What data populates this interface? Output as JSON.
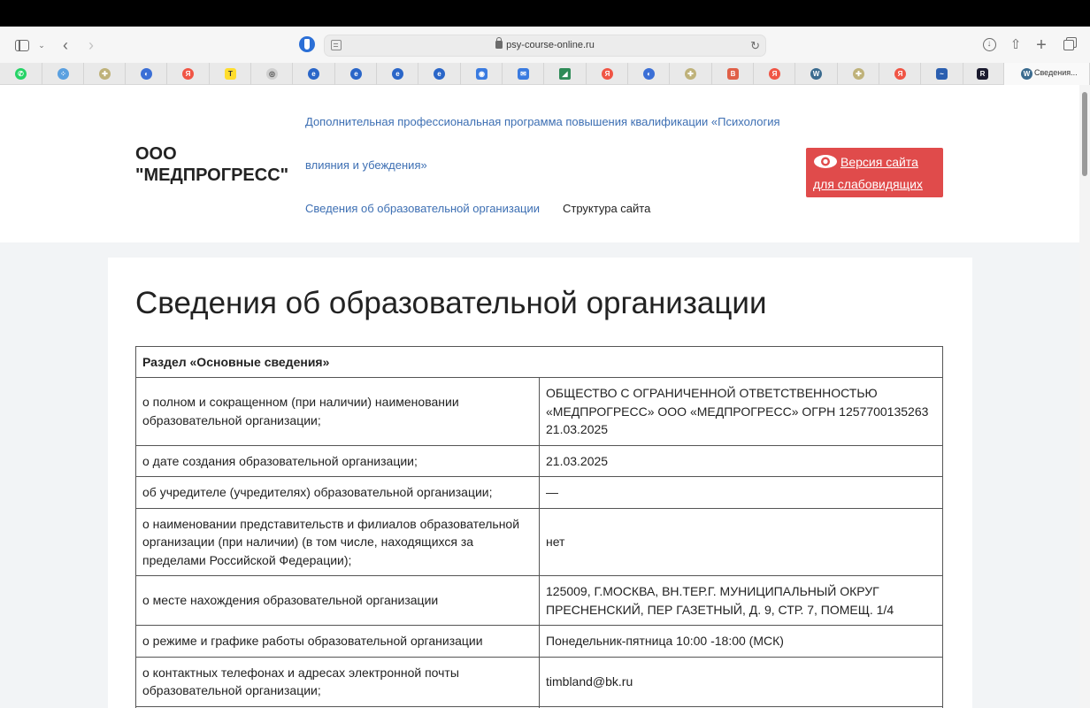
{
  "browser": {
    "url": "psy-course-online.ru",
    "active_tab_label": "Сведения...",
    "tab_icons": [
      "whatsapp-icon",
      "apps-icon",
      "medical-cross-icon",
      "chrome-icon",
      "yandex-icon",
      "tinkoff-icon",
      "university-icon",
      "edge-icon",
      "edge-icon",
      "edge-icon",
      "edge-icon",
      "circle-app-icon",
      "mail-icon",
      "chart-icon",
      "yandex-icon",
      "chrome-icon",
      "medical-cross-icon",
      "red-app-icon",
      "yandex-icon",
      "wordpress-icon",
      "medical-cross-icon",
      "yandex-icon",
      "wave-icon",
      "app-r-icon",
      "wordpress-icon"
    ]
  },
  "site": {
    "brand": "ООО \"МЕДПРОГРЕСС\"",
    "nav": {
      "program_line1": "Дополнительная профессиональная программа повышения квалификации «Психология",
      "program_line2": "влияния и убеждения»",
      "info": "Сведения об образовательной организации",
      "structure": "Структура сайта"
    },
    "accessibility_button": "Версия сайта для слабовидящих",
    "colors": {
      "accent": "#e04b4b",
      "link": "#3d6fb3",
      "page_bg": "#f2f4f6"
    }
  },
  "main": {
    "title": "Сведения об образовательной организации",
    "section_header": "Раздел «Основные сведения»",
    "rows": [
      {
        "label": "о полном и сокращенном (при наличии) наименовании образовательной организации;",
        "value": "ОБЩЕСТВО С ОГРАНИЧЕННОЙ ОТВЕТСТВЕННОСТЬЮ «МЕДПРОГРЕСС» ООО «МЕДПРОГРЕСС» ОГРН 1257700135263 21.03.2025"
      },
      {
        "label": "о дате создания образовательной организации;",
        "value": "21.03.2025"
      },
      {
        "label": "об учредителе (учредителях) образовательной организации;",
        "value": "—"
      },
      {
        "label": "о наименовании представительств и филиалов образовательной организации (при наличии) (в том числе, находящихся за пределами Российской Федерации);",
        "value": " нет"
      },
      {
        "label": "о месте нахождения образовательной организации",
        "value": "125009, Г.МОСКВА, ВН.ТЕР.Г. МУНИЦИПАЛЬНЫЙ ОКРУГ ПРЕСНЕНСКИЙ, ПЕР ГАЗЕТНЫЙ, Д. 9, СТР. 7, ПОМЕЩ. 1/4"
      },
      {
        "label": "о режиме и графике работы образовательной организации",
        "value": "Понедельник-пятница 10:00 -18:00 (МСК)"
      },
      {
        "label": "о контактных телефонах и адресах электронной почты образовательной организации;",
        "value": "timbland@bk.ru"
      },
      {
        "label": "",
        "value": ""
      }
    ]
  }
}
